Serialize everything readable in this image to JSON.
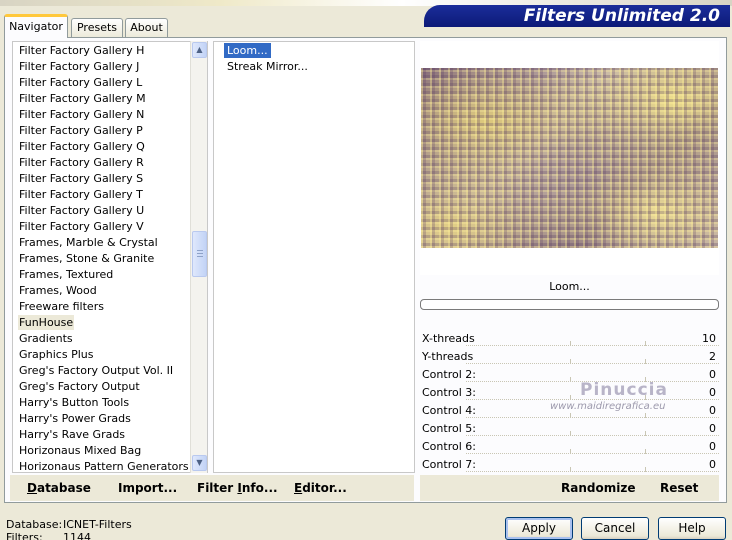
{
  "app": {
    "banner_title": "Filters Unlimited 2.0"
  },
  "tabs": [
    {
      "label": "Navigator",
      "active": true
    },
    {
      "label": "Presets",
      "active": false
    },
    {
      "label": "About",
      "active": false
    }
  ],
  "categories": {
    "items": [
      "Filter Factory Gallery H",
      "Filter Factory Gallery J",
      "Filter Factory Gallery L",
      "Filter Factory Gallery M",
      "Filter Factory Gallery N",
      "Filter Factory Gallery P",
      "Filter Factory Gallery Q",
      "Filter Factory Gallery R",
      "Filter Factory Gallery S",
      "Filter Factory Gallery T",
      "Filter Factory Gallery U",
      "Filter Factory Gallery V",
      "Frames, Marble & Crystal",
      "Frames, Stone & Granite",
      "Frames, Textured",
      "Frames, Wood",
      "Freeware filters",
      "FunHouse",
      "Gradients",
      "Graphics Plus",
      "Greg's Factory Output Vol. II",
      "Greg's Factory Output",
      "Harry's Button Tools",
      "Harry's Power Grads",
      "Harry's Rave Grads",
      "Horizonaus Mixed Bag",
      "Horizonaus Pattern Generators"
    ],
    "selected": "FunHouse"
  },
  "filters": {
    "items": [
      "Loom...",
      "Streak Mirror..."
    ],
    "selected": "Loom..."
  },
  "preview": {
    "label": "Loom...",
    "progress": 0
  },
  "controls": [
    {
      "name": "X-threads",
      "value": "10"
    },
    {
      "name": "Y-threads",
      "value": "2"
    },
    {
      "name": "Control 2:",
      "value": "0"
    },
    {
      "name": "Control 3:",
      "value": "0"
    },
    {
      "name": "Control 4:",
      "value": "0"
    },
    {
      "name": "Control 5:",
      "value": "0"
    },
    {
      "name": "Control 6:",
      "value": "0"
    },
    {
      "name": "Control 7:",
      "value": "0"
    }
  ],
  "watermark": {
    "title": "Pinuccia",
    "url": "www.maidiregrafica.eu"
  },
  "left_buttons": {
    "database": {
      "hot": "D",
      "rest": "atabase"
    },
    "import": {
      "pre": "Import",
      "post": "..."
    },
    "filter_info": {
      "pre": "Filter ",
      "hot": "I",
      "post": "nfo..."
    },
    "editor": {
      "hot": "E",
      "post": "ditor..."
    }
  },
  "right_buttons": {
    "randomize": "Randomize",
    "reset": "Reset"
  },
  "status": {
    "database_label": "Database:",
    "database_value": "ICNET-Filters",
    "filters_label": "Filters:",
    "filters_value": "1144"
  },
  "actions": {
    "apply": "Apply",
    "cancel": "Cancel",
    "help": "Help"
  },
  "colors": {
    "selection": "#316ac5",
    "banner": "#0c1a78",
    "tab_accent": "#ffc83c",
    "window_bg": "#ece9d8"
  }
}
